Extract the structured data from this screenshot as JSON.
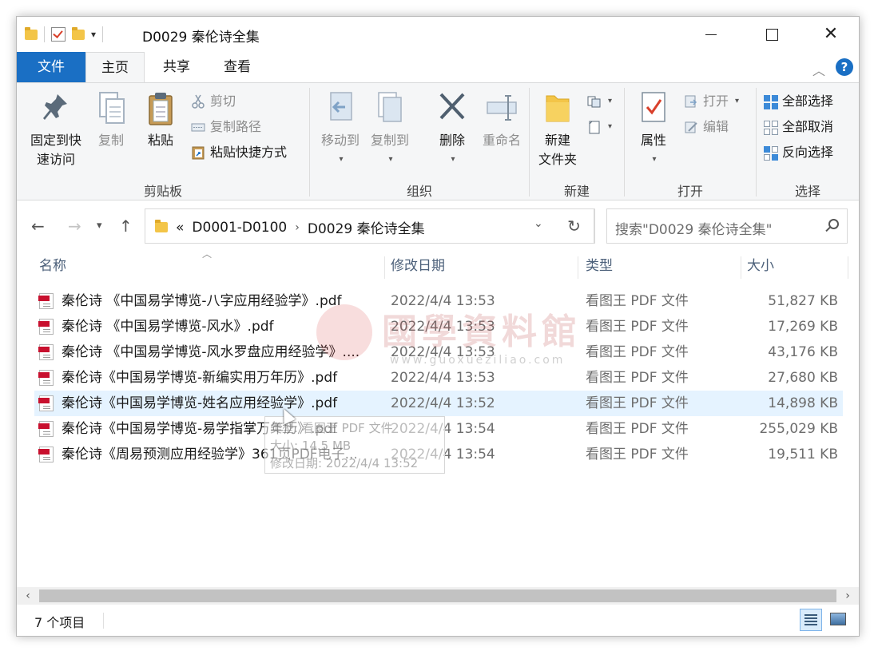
{
  "window": {
    "title": "D0029 秦伦诗全集"
  },
  "ribbon_tabs": {
    "file": "文件",
    "home": "主页",
    "share": "共享",
    "view": "查看"
  },
  "ribbon": {
    "clipboard": {
      "label": "剪贴板",
      "pin": "固定到快\n速访问",
      "pin_l1": "固定到快",
      "pin_l2": "速访问",
      "copy": "复制",
      "paste": "粘贴",
      "cut": "剪切",
      "copy_path": "复制路径",
      "paste_shortcut": "粘贴快捷方式"
    },
    "organize": {
      "label": "组织",
      "move_to": "移动到",
      "copy_to": "复制到",
      "delete": "删除",
      "rename": "重命名"
    },
    "new": {
      "label": "新建",
      "new_folder_l1": "新建",
      "new_folder_l2": "文件夹"
    },
    "open": {
      "label": "打开",
      "properties": "属性",
      "open": "打开",
      "edit": "编辑"
    },
    "select": {
      "label": "选择",
      "select_all": "全部选择",
      "select_none": "全部取消",
      "invert": "反向选择"
    }
  },
  "address": {
    "overflow": "«",
    "crumbs": [
      "D0001-D0100",
      "D0029 秦伦诗全集"
    ],
    "search_placeholder": "搜索\"D0029 秦伦诗全集\""
  },
  "columns": {
    "name": "名称",
    "date": "修改日期",
    "type": "类型",
    "size": "大小"
  },
  "files": [
    {
      "name": "秦伦诗 《中国易学博览-八字应用经验学》.pdf",
      "date": "2022/4/4 13:53",
      "type": "看图王 PDF 文件",
      "size": "51,827 KB"
    },
    {
      "name": "秦伦诗 《中国易学博览-风水》.pdf",
      "date": "2022/4/4 13:53",
      "type": "看图王 PDF 文件",
      "size": "17,269 KB"
    },
    {
      "name": "秦伦诗 《中国易学博览-风水罗盘应用经验学》....",
      "date": "2022/4/4 13:53",
      "type": "看图王 PDF 文件",
      "size": "43,176 KB"
    },
    {
      "name": "秦伦诗《中国易学博览-新编实用万年历》.pdf",
      "date": "2022/4/4 13:53",
      "type": "看图王 PDF 文件",
      "size": "27,680 KB"
    },
    {
      "name": "秦伦诗《中国易学博览-姓名应用经验学》.pdf",
      "date": "2022/4/4 13:52",
      "type": "看图王 PDF 文件",
      "size": "14,898 KB"
    },
    {
      "name": "秦伦诗《中国易学博览-易学指掌万年历》.pdf",
      "date": "2022/4/4 13:54",
      "type": "看图王 PDF 文件",
      "size": "255,029 KB"
    },
    {
      "name": "秦伦诗《周易预测应用经验学》361页PDF电子...",
      "date": "2022/4/4 13:54",
      "type": "看图王 PDF 文件",
      "size": "19,511 KB"
    }
  ],
  "watermark": {
    "text": "國學資料館",
    "url": "www.guoxueziliao.com"
  },
  "tooltip": {
    "type": "类型: 看图王 PDF 文件",
    "size": "大小: 14.5 MB",
    "date": "修改日期: 2022/4/4 13:52"
  },
  "status": {
    "count": "7 个项目"
  },
  "colors": {
    "accent": "#1a6fc4",
    "selection": "#e5f3ff",
    "pdf_red": "#c8102e"
  }
}
